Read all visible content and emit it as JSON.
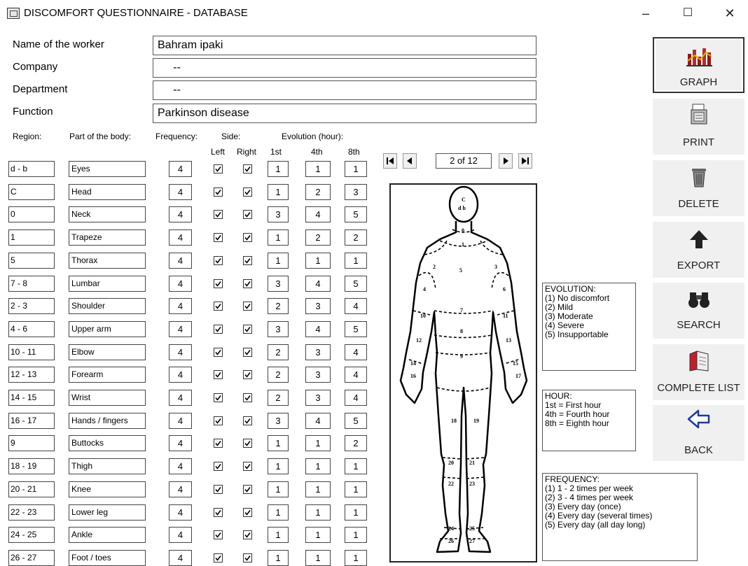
{
  "window": {
    "title": "DISCOMFORT QUESTIONNAIRE - DATABASE",
    "minimize": "–",
    "maximize": "☐",
    "close": "✕"
  },
  "info": [
    {
      "label": "Name of the worker",
      "value": "Bahram ipaki"
    },
    {
      "label": "Company",
      "value": "     --"
    },
    {
      "label": "Department",
      "value": "     --"
    },
    {
      "label": "Function",
      "value": "Parkinson disease"
    }
  ],
  "headers": {
    "region": "Region:",
    "part": "Part of the body:",
    "frequency": "Frequency:",
    "side": "Side:",
    "left": "Left",
    "right": "Right",
    "evolution": "Evolution (hour):",
    "h1": "1st",
    "h4": "4th",
    "h8": "8th"
  },
  "rows": [
    {
      "region": "d - b",
      "part": "Eyes",
      "freq": "4",
      "left": true,
      "right": true,
      "e1": "1",
      "e4": "1",
      "e8": "1"
    },
    {
      "region": "C",
      "part": "Head",
      "freq": "4",
      "left": true,
      "right": true,
      "e1": "1",
      "e4": "2",
      "e8": "3"
    },
    {
      "region": "0",
      "part": "Neck",
      "freq": "4",
      "left": true,
      "right": true,
      "e1": "3",
      "e4": "4",
      "e8": "5"
    },
    {
      "region": "1",
      "part": "Trapeze",
      "freq": "4",
      "left": true,
      "right": true,
      "e1": "1",
      "e4": "2",
      "e8": "2"
    },
    {
      "region": "5",
      "part": "Thorax",
      "freq": "4",
      "left": true,
      "right": true,
      "e1": "1",
      "e4": "1",
      "e8": "1"
    },
    {
      "region": "7 - 8",
      "part": "Lumbar",
      "freq": "4",
      "left": true,
      "right": true,
      "e1": "3",
      "e4": "4",
      "e8": "5"
    },
    {
      "region": "2 - 3",
      "part": "Shoulder",
      "freq": "4",
      "left": true,
      "right": true,
      "e1": "2",
      "e4": "3",
      "e8": "4"
    },
    {
      "region": "4 - 6",
      "part": "Upper arm",
      "freq": "4",
      "left": true,
      "right": true,
      "e1": "3",
      "e4": "4",
      "e8": "5"
    },
    {
      "region": "10 - 11",
      "part": "Elbow",
      "freq": "4",
      "left": true,
      "right": true,
      "e1": "2",
      "e4": "3",
      "e8": "4"
    },
    {
      "region": "12 - 13",
      "part": "Forearm",
      "freq": "4",
      "left": true,
      "right": true,
      "e1": "2",
      "e4": "3",
      "e8": "4"
    },
    {
      "region": "14 - 15",
      "part": "Wrist",
      "freq": "4",
      "left": true,
      "right": true,
      "e1": "2",
      "e4": "3",
      "e8": "4"
    },
    {
      "region": "16 - 17",
      "part": "Hands / fingers",
      "freq": "4",
      "left": true,
      "right": true,
      "e1": "3",
      "e4": "4",
      "e8": "5"
    },
    {
      "region": "9",
      "part": "Buttocks",
      "freq": "4",
      "left": true,
      "right": true,
      "e1": "1",
      "e4": "1",
      "e8": "2"
    },
    {
      "region": "18 - 19",
      "part": "Thigh",
      "freq": "4",
      "left": true,
      "right": true,
      "e1": "1",
      "e4": "1",
      "e8": "1"
    },
    {
      "region": "20 - 21",
      "part": "Knee",
      "freq": "4",
      "left": true,
      "right": true,
      "e1": "1",
      "e4": "1",
      "e8": "1"
    },
    {
      "region": "22 - 23",
      "part": "Lower leg",
      "freq": "4",
      "left": true,
      "right": true,
      "e1": "1",
      "e4": "1",
      "e8": "1"
    },
    {
      "region": "24 - 25",
      "part": "Ankle",
      "freq": "4",
      "left": true,
      "right": true,
      "e1": "1",
      "e4": "1",
      "e8": "1"
    },
    {
      "region": "26 - 27",
      "part": "Foot / toes",
      "freq": "4",
      "left": true,
      "right": true,
      "e1": "1",
      "e4": "1",
      "e8": "1"
    }
  ],
  "navigator": {
    "counter": "2 of 12"
  },
  "figure": {
    "labels": [
      "C",
      "d b",
      "0",
      "1",
      "2",
      "3",
      "5",
      "4",
      "6",
      "7",
      "10",
      "11",
      "8",
      "12",
      "13",
      "9",
      "14",
      "15",
      "16",
      "17",
      "18",
      "19",
      "20",
      "21",
      "22",
      "23",
      "24",
      "25",
      "26",
      "27"
    ]
  },
  "legends": {
    "evolution": [
      "EVOLUTION:",
      "(1) No discomfort",
      "(2) Mild",
      "(3) Moderate",
      "(4) Severe",
      "(5) Insupportable"
    ],
    "hour": [
      "HOUR:",
      "1st = First hour",
      "4th = Fourth hour",
      "8th = Eighth hour"
    ],
    "frequency": [
      "FREQUENCY:",
      "(1) 1 - 2 times per week",
      "(2) 3 - 4 times per week",
      "(3) Every day (once)",
      "(4) Every day (several times)",
      "(5) Every day (all day long)"
    ]
  },
  "buttons": {
    "graph": "GRAPH",
    "print": "PRINT",
    "delete": "DELETE",
    "export": "EXPORT",
    "search": "SEARCH",
    "complete_list": "COMPLETE LIST",
    "back": "BACK"
  },
  "icons": {
    "graph": "bar-chart-icon",
    "print": "printer-icon",
    "delete": "trash-can-icon",
    "export": "up-arrow-icon",
    "search": "binoculars-icon",
    "complete_list": "book-icon",
    "back": "left-arrow-icon"
  }
}
